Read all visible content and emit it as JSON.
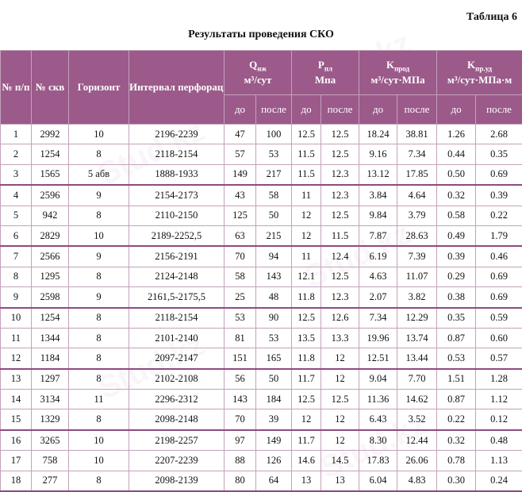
{
  "table_number": "Таблица 6",
  "caption": "Результаты проведения СКО",
  "headers": {
    "num": "№ п/п",
    "well": "№ скв",
    "horizon": "Горизонт",
    "interval": "Интервал перфорации, м",
    "q": {
      "sym": "Q",
      "sub": "нж",
      "unit": "м³/сут"
    },
    "p": {
      "sym": "P",
      "sub": "пл",
      "unit": "Мпа"
    },
    "k_prod": {
      "sym": "K",
      "sub": "прод",
      "unit": "м³/сут·МПа"
    },
    "k_spec": {
      "sym": "K",
      "sub": "пр.уд",
      "unit": "м³/сут·МПа·м"
    },
    "before": "до",
    "after": "после"
  },
  "rows": [
    [
      "1",
      "2992",
      "10",
      "2196-2239",
      "47",
      "100",
      "12.5",
      "12.5",
      "18.24",
      "38.81",
      "1.26",
      "2.68"
    ],
    [
      "2",
      "1254",
      "8",
      "2118-2154",
      "57",
      "53",
      "11.5",
      "12.5",
      "9.16",
      "7.34",
      "0.44",
      "0.35"
    ],
    [
      "3",
      "1565",
      "5 абв",
      "1888-1933",
      "149",
      "217",
      "11.5",
      "12.3",
      "13.12",
      "17.85",
      "0.50",
      "0.69"
    ],
    [
      "4",
      "2596",
      "9",
      "2154-2173",
      "43",
      "58",
      "11",
      "12.3",
      "3.84",
      "4.64",
      "0.32",
      "0.39"
    ],
    [
      "5",
      "942",
      "8",
      "2110-2150",
      "125",
      "50",
      "12",
      "12.5",
      "9.84",
      "3.79",
      "0.58",
      "0.22"
    ],
    [
      "6",
      "2829",
      "10",
      "2189-2252,5",
      "63",
      "215",
      "12",
      "11.5",
      "7.87",
      "28.63",
      "0.49",
      "1.79"
    ],
    [
      "7",
      "2566",
      "9",
      "2156-2191",
      "70",
      "94",
      "11",
      "12.4",
      "6.19",
      "7.39",
      "0.39",
      "0.46"
    ],
    [
      "8",
      "1295",
      "8",
      "2124-2148",
      "58",
      "143",
      "12.1",
      "12.5",
      "4.63",
      "11.07",
      "0.29",
      "0.69"
    ],
    [
      "9",
      "2598",
      "9",
      "2161,5-2175,5",
      "25",
      "48",
      "11.8",
      "12.3",
      "2.07",
      "3.82",
      "0.38",
      "0.69"
    ],
    [
      "10",
      "1254",
      "8",
      "2118-2154",
      "53",
      "90",
      "12.5",
      "12.6",
      "7.34",
      "12.29",
      "0.35",
      "0.59"
    ],
    [
      "11",
      "1344",
      "8",
      "2101-2140",
      "81",
      "53",
      "13.5",
      "13.3",
      "19.96",
      "13.74",
      "0.87",
      "0.60"
    ],
    [
      "12",
      "1184",
      "8",
      "2097-2147",
      "151",
      "165",
      "11.8",
      "12",
      "12.51",
      "13.44",
      "0.53",
      "0.57"
    ],
    [
      "13",
      "1297",
      "8",
      "2102-2108",
      "56",
      "50",
      "11.7",
      "12",
      "9.04",
      "7.70",
      "1.51",
      "1.28"
    ],
    [
      "14",
      "3134",
      "11",
      "2296-2312",
      "143",
      "184",
      "12.5",
      "12.5",
      "11.36",
      "14.62",
      "0.87",
      "1.12"
    ],
    [
      "15",
      "1329",
      "8",
      "2098-2148",
      "70",
      "39",
      "12",
      "12",
      "6.43",
      "3.52",
      "0.22",
      "0.12"
    ],
    [
      "16",
      "3265",
      "10",
      "2198-2257",
      "97",
      "149",
      "11.7",
      "12",
      "8.30",
      "12.44",
      "0.32",
      "0.48"
    ],
    [
      "17",
      "758",
      "10",
      "2207-2239",
      "88",
      "126",
      "14.6",
      "14.5",
      "17.83",
      "26.06",
      "0.78",
      "1.13"
    ],
    [
      "18",
      "277",
      "8",
      "2098-2139",
      "80",
      "64",
      "13",
      "13",
      "6.04",
      "4.83",
      "0.30",
      "0.24"
    ]
  ],
  "watermark": "Stud.kz"
}
